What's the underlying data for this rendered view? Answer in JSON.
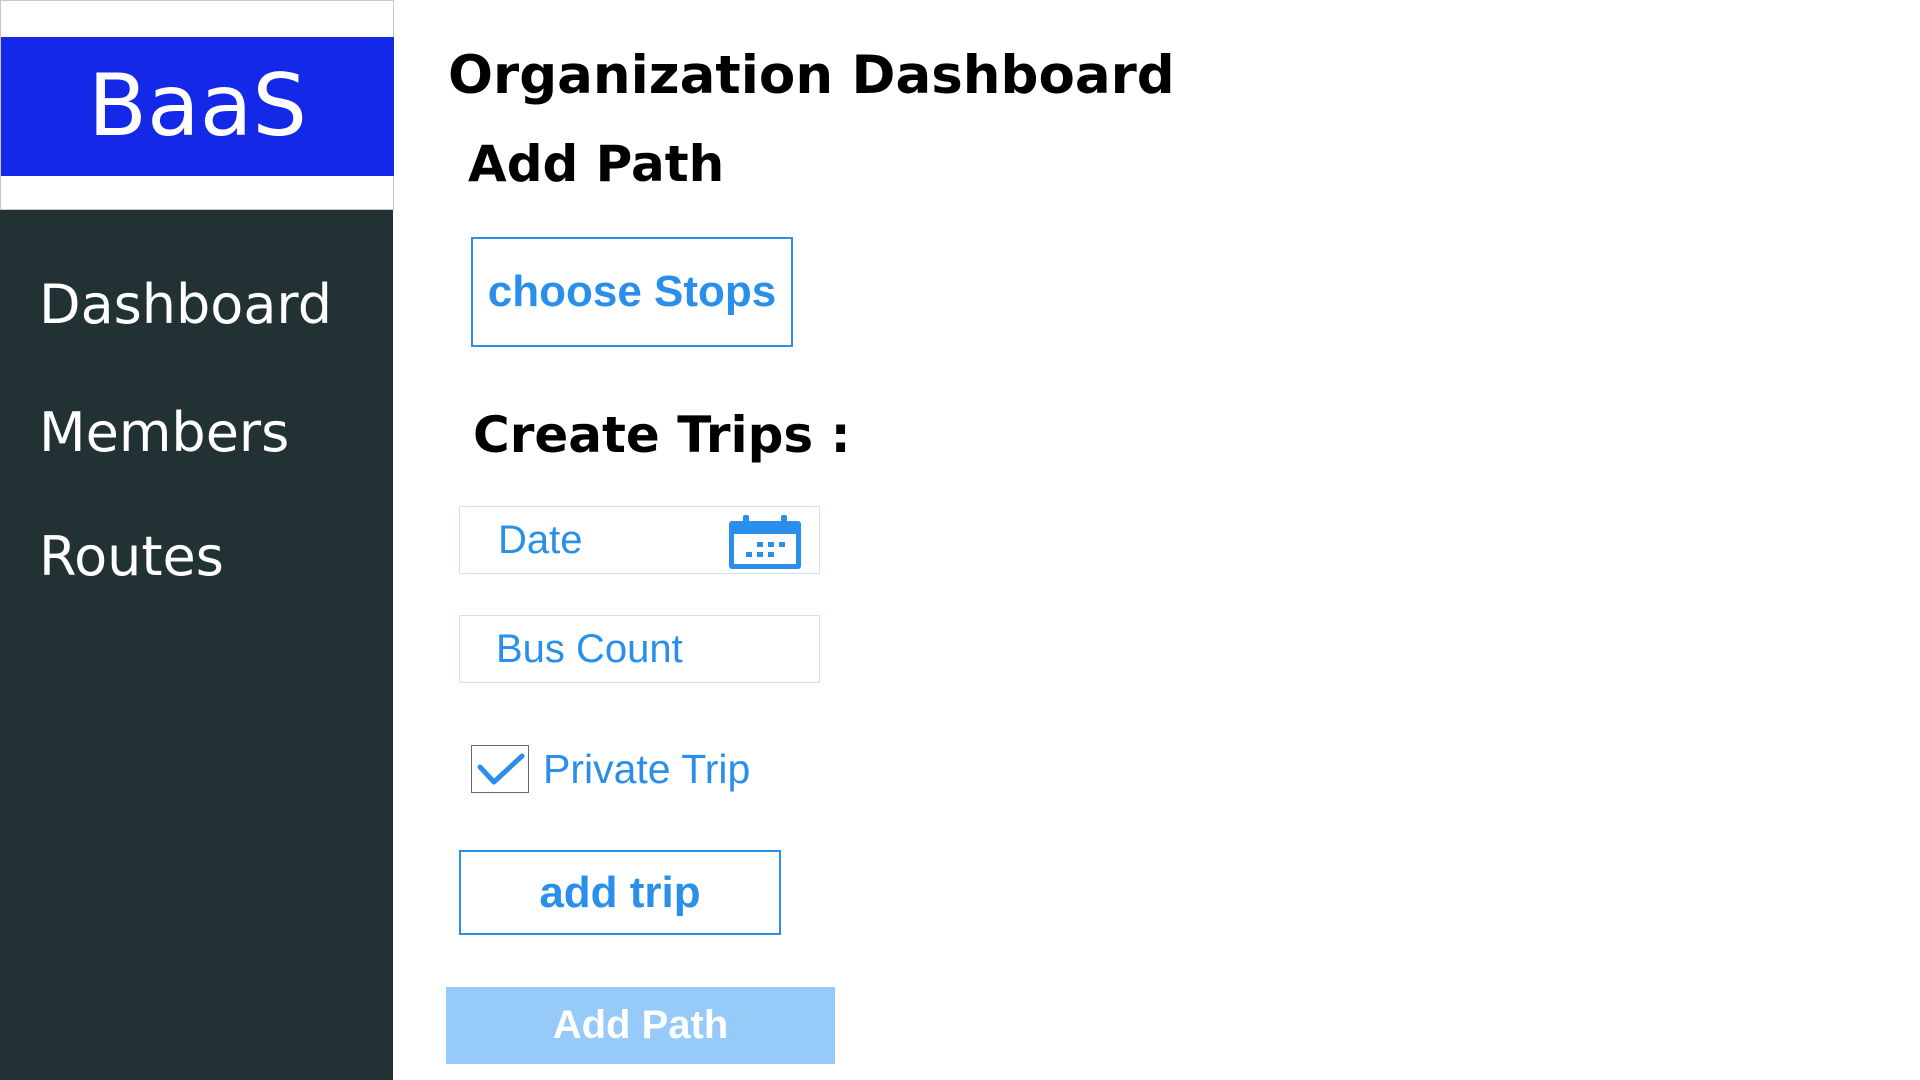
{
  "sidebar": {
    "brand": "BaaS",
    "items": [
      {
        "label": "Dashboard"
      },
      {
        "label": "Members"
      },
      {
        "label": "Routes"
      }
    ]
  },
  "main": {
    "title": "Organization Dashboard",
    "add_path_heading": "Add Path",
    "choose_stops_label": "choose Stops",
    "create_trips_heading": "Create Trips :",
    "date_field": {
      "placeholder": "Date",
      "icon": "calendar-icon"
    },
    "bus_count_field": {
      "placeholder": "Bus Count"
    },
    "private_trip": {
      "label": "Private Trip",
      "checked": true,
      "icon": "checkmark-icon"
    },
    "add_trip_label": "add trip",
    "add_path_button_label": "Add Path"
  },
  "colors": {
    "brand_background": "#1428e8",
    "sidebar_background": "#223134",
    "accent": "#2a8fea",
    "primary_button_background": "#96cbf9"
  }
}
